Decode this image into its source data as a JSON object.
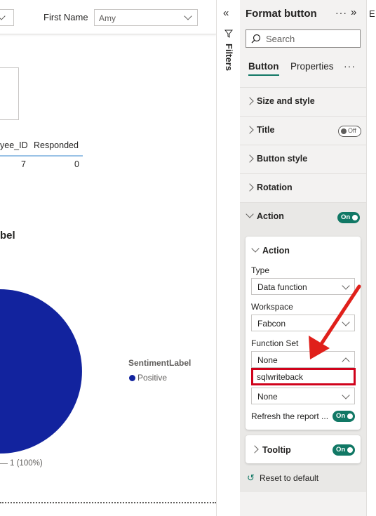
{
  "slicer": {
    "label": "First Name",
    "value": "Amy"
  },
  "table": {
    "headers": [
      "yee_ID",
      "Responded"
    ],
    "rows": [
      [
        "7",
        "0"
      ]
    ]
  },
  "pie": {
    "title": "bel",
    "legend_title": "SentimentLabel",
    "legend_items": [
      {
        "label": "Positive",
        "color": "#12239e"
      }
    ],
    "slice_label": "1 (100%)"
  },
  "filters": {
    "label": "Filters"
  },
  "pane": {
    "title": "Format button",
    "search_placeholder": "Search",
    "tabs": [
      "Button",
      "Properties"
    ],
    "more_label": "···",
    "sections": {
      "size_style": "Size and style",
      "title": "Title",
      "title_toggle": "Off",
      "button_style": "Button style",
      "rotation": "Rotation",
      "action": "Action",
      "action_toggle": "On"
    },
    "action_card": {
      "heading": "Action",
      "type_label": "Type",
      "type_value": "Data function",
      "workspace_label": "Workspace",
      "workspace_value": "Fabcon",
      "function_set_label": "Function Set",
      "function_set_value": "None",
      "function_set_option": "sqlwriteback",
      "function_value": "None",
      "refresh_label": "Refresh the report ...",
      "refresh_toggle": "On"
    },
    "tooltip": {
      "label": "Tooltip",
      "toggle": "On"
    },
    "reset_label": "Reset to default"
  },
  "right_strip_letter": "E",
  "colors": {
    "accent": "#117865",
    "pie": "#12239e",
    "highlight": "#d0021b",
    "arrow": "#e0201b"
  }
}
